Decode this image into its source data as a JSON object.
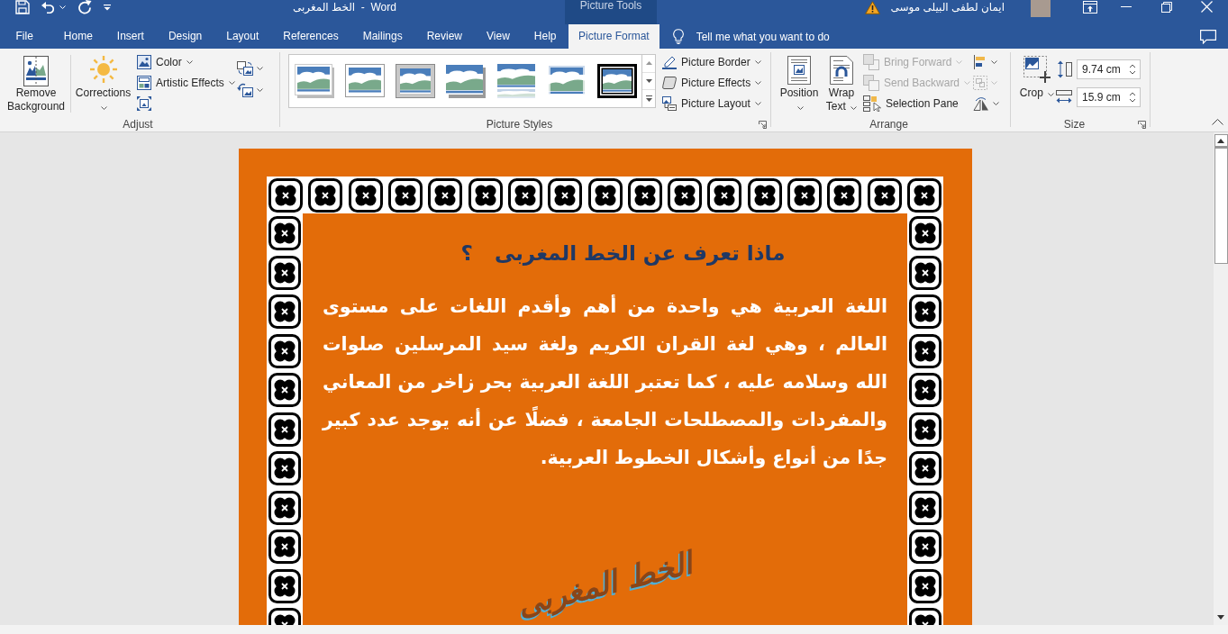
{
  "window": {
    "title": "الخط المغربى  -  Word",
    "contextual_group": "Picture Tools",
    "user_name": "ايمان لطفى البيلى موسى"
  },
  "tabs": [
    {
      "label": "File",
      "selected": false
    },
    {
      "label": "Home",
      "selected": false
    },
    {
      "label": "Insert",
      "selected": false
    },
    {
      "label": "Design",
      "selected": false
    },
    {
      "label": "Layout",
      "selected": false
    },
    {
      "label": "References",
      "selected": false
    },
    {
      "label": "Mailings",
      "selected": false
    },
    {
      "label": "Review",
      "selected": false
    },
    {
      "label": "View",
      "selected": false
    },
    {
      "label": "Help",
      "selected": false
    },
    {
      "label": "Picture Format",
      "selected": true
    }
  ],
  "tell_me": {
    "placeholder": "Tell me what you want to do"
  },
  "ribbon": {
    "adjust": {
      "label": "Adjust",
      "big_buttons": [
        {
          "label": "Remove Background",
          "dropdown": false
        },
        {
          "label": "Corrections",
          "dropdown": true
        }
      ],
      "small_buttons": [
        {
          "label": "Color",
          "dropdown": true
        },
        {
          "label": "Artistic Effects",
          "dropdown": true
        }
      ]
    },
    "picture_styles": {
      "label": "Picture Styles",
      "buttons": [
        {
          "label": "Picture Border",
          "dropdown": true
        },
        {
          "label": "Picture Effects",
          "dropdown": true
        },
        {
          "label": "Picture Layout",
          "dropdown": true
        }
      ]
    },
    "arrange": {
      "label": "Arrange",
      "big_buttons": [
        {
          "label": "Position",
          "dropdown": true
        },
        {
          "label": "Wrap Text",
          "dropdown": true
        }
      ],
      "small_buttons": [
        {
          "label": "Bring Forward",
          "dropdown": true,
          "disabled": true
        },
        {
          "label": "Send Backward",
          "dropdown": true,
          "disabled": true
        },
        {
          "label": "Selection Pane",
          "dropdown": false,
          "disabled": false
        }
      ],
      "tools": [
        {
          "disabled": false
        },
        {
          "disabled": true
        },
        {
          "disabled": false
        }
      ]
    },
    "size": {
      "label": "Size",
      "crop": {
        "label": "Crop",
        "dropdown": true
      },
      "height": {
        "value": "9.74 cm"
      },
      "width": {
        "value": "15.9 cm"
      }
    }
  },
  "document": {
    "title": "ماذا تعرف عن الخط المغربى   ؟",
    "paragraph": "اللغة العربية هي واحدة من أهم وأقدم اللغات على مستوى العالم ، وهي لغة القران الكريم ولغة سيد المرسلين صلوات الله وسلامه عليه ، كما تعتبر اللغة العربية بحر زاخر من المعاني والمفردات والمصطلحات الجامعة ، فضلًا عن أنه يوجد عدد كبير جدًا من أنواع وأشكال الخطوط العربية.",
    "calligraphy": "الخط المغربى"
  }
}
